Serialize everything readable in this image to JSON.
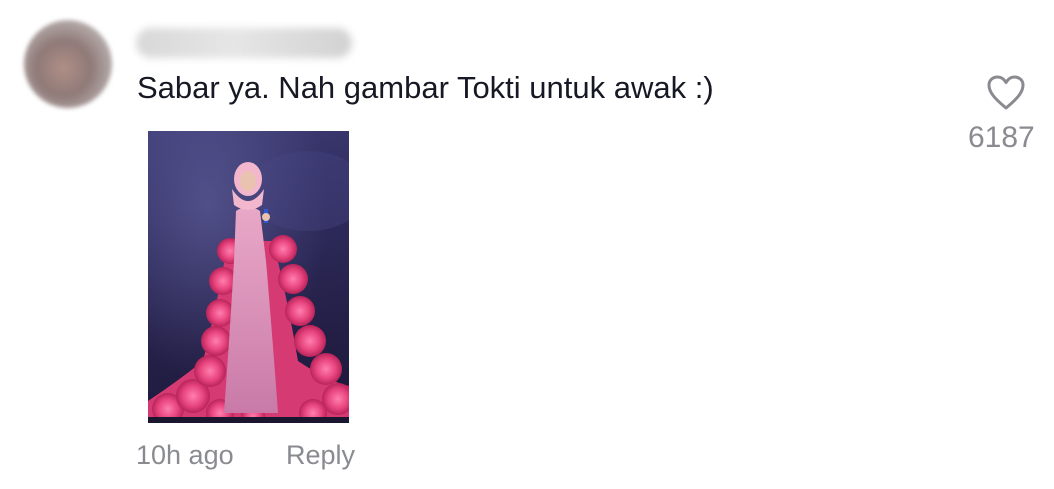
{
  "comment": {
    "text": "Sabar ya. Nah gambar Tokti untuk awak :)",
    "timestamp": "10h ago",
    "reply_label": "Reply",
    "like_count": "6187",
    "image_icon": "photo-of-performer-in-pink-gown"
  },
  "colors": {
    "text_primary": "#161823",
    "text_secondary": "#8a8b91",
    "icon_stroke": "#8a8b91",
    "gown_pink": "#e8457e",
    "stage_background": "#2e2b5c"
  }
}
